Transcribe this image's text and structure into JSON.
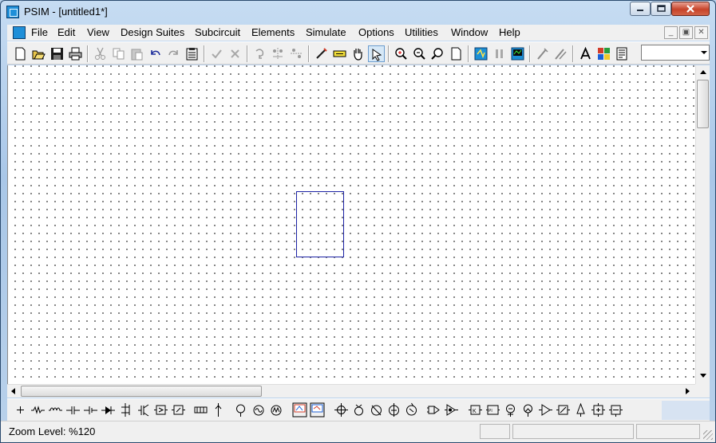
{
  "window": {
    "title": "PSIM - [untitled1*]"
  },
  "menu": {
    "items": [
      "File",
      "Edit",
      "View",
      "Design Suites",
      "Subcircuit",
      "Elements",
      "Simulate",
      "Options",
      "Utilities",
      "Window",
      "Help"
    ]
  },
  "toolbar": {
    "buttons": [
      "new-icon",
      "open-icon",
      "save-icon",
      "print-icon",
      "cut-icon",
      "copy-icon",
      "paste-icon",
      "undo-icon",
      "redo-icon",
      "clipboard-icon",
      "check-icon",
      "cross-icon",
      "rotate-icon",
      "flip-lr-icon",
      "flip-ud-icon",
      "wire-icon",
      "label-icon",
      "pan-hand-icon",
      "select-arrow-icon",
      "zoom-in-icon",
      "zoom-out-icon",
      "zoom-select-icon",
      "fit-page-icon",
      "run-simulation-icon",
      "pause-icon",
      "simview-icon",
      "probe-icon",
      "probe-multi-icon",
      "text-icon",
      "element-list-icon",
      "netlist-icon"
    ],
    "combo_value": ""
  },
  "elements_toolbar": {
    "buttons": [
      "ground-icon",
      "resistor-icon",
      "inductor-icon",
      "capacitor-icon",
      "electrolytic-cap-icon",
      "diode-icon",
      "thyristor-icon",
      "igbt-icon",
      "mosfet-icon",
      "switch-icon",
      "transformer-icon",
      "coupled-inductor-icon",
      "voltage-source-icon",
      "ac-source-icon",
      "current-source-icon",
      "voltmeter-icon",
      "ammeter-icon",
      "voltage-probe-icon",
      "current-probe-icon",
      "dc-voltage-source-icon",
      "ac-voltage-source-icon",
      "wattmeter-icon",
      "comparator-icon",
      "op-amp-icon",
      "pi-controller-icon",
      "pid-controller-icon",
      "ac-sweep-icon",
      "sensor-icon",
      "adder-icon",
      "summer-icon",
      "limiter-icon",
      "gain-icon",
      "transfer-function-icon",
      "gating-block-icon",
      "motor-icon",
      "load-icon",
      "generator-icon"
    ]
  },
  "status": {
    "zoom_text": "Zoom Level: %120"
  }
}
